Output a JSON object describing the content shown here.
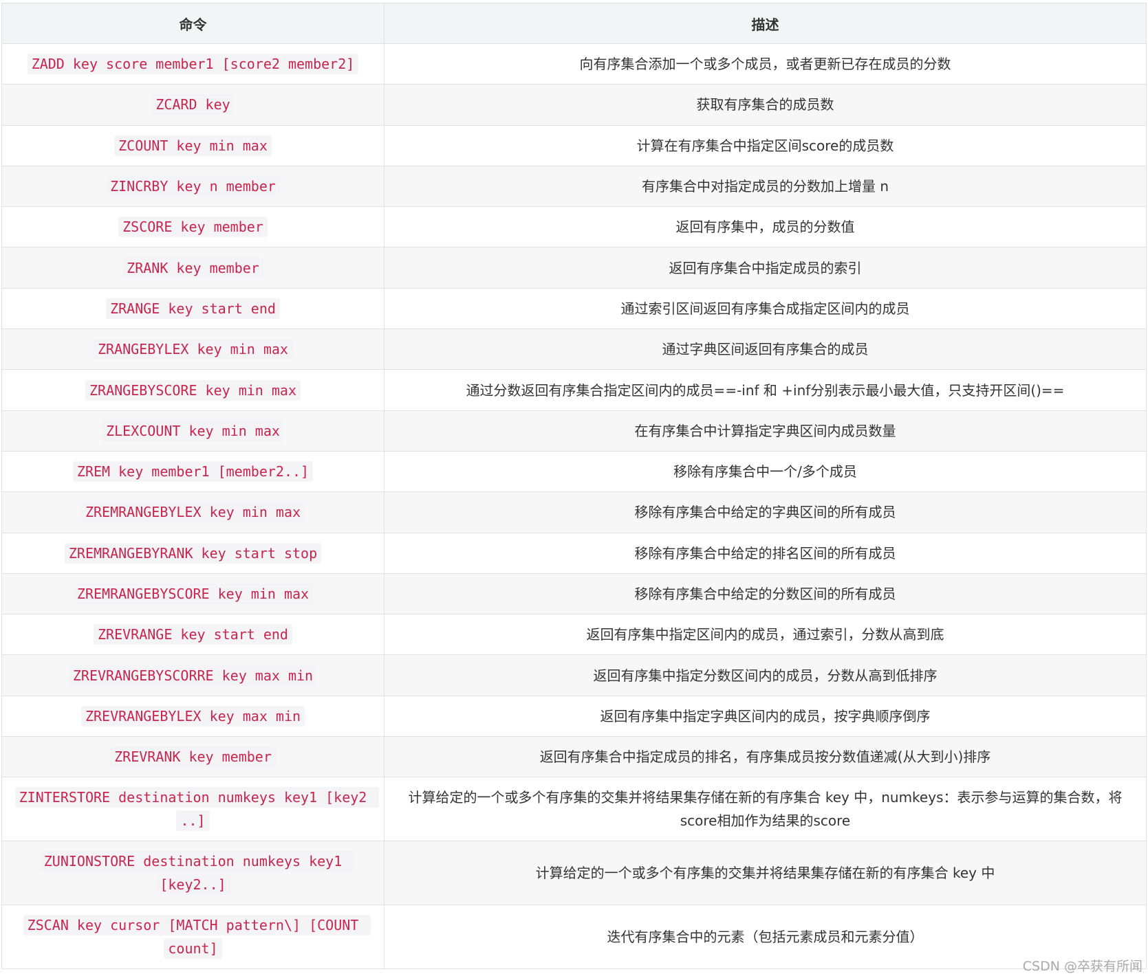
{
  "table": {
    "headers": [
      "命令",
      "描述"
    ],
    "rows": [
      {
        "command": "ZADD key score member1 [score2 member2]",
        "description": "向有序集合添加一个或多个成员，或者更新已存在成员的分数"
      },
      {
        "command": "ZCARD key",
        "description": "获取有序集合的成员数"
      },
      {
        "command": "ZCOUNT key min max",
        "description": "计算在有序集合中指定区间score的成员数"
      },
      {
        "command": "ZINCRBY key n member",
        "description": "有序集合中对指定成员的分数加上增量 n"
      },
      {
        "command": "ZSCORE key member",
        "description": "返回有序集中，成员的分数值"
      },
      {
        "command": "ZRANK key member",
        "description": "返回有序集合中指定成员的索引"
      },
      {
        "command": "ZRANGE key start end",
        "description": "通过索引区间返回有序集合成指定区间内的成员"
      },
      {
        "command": "ZRANGEBYLEX key min max",
        "description": "通过字典区间返回有序集合的成员"
      },
      {
        "command": "ZRANGEBYSCORE key min max",
        "description": "通过分数返回有序集合指定区间内的成员==-inf 和 +inf分别表示最小最大值，只支持开区间()=="
      },
      {
        "command": "ZLEXCOUNT key min max",
        "description": "在有序集合中计算指定字典区间内成员数量"
      },
      {
        "command": "ZREM key member1 [member2..]",
        "description": "移除有序集合中一个/多个成员"
      },
      {
        "command": "ZREMRANGEBYLEX key min max",
        "description": "移除有序集合中给定的字典区间的所有成员"
      },
      {
        "command": "ZREMRANGEBYRANK key start stop",
        "description": "移除有序集合中给定的排名区间的所有成员"
      },
      {
        "command": "ZREMRANGEBYSCORE key min max",
        "description": "移除有序集合中给定的分数区间的所有成员"
      },
      {
        "command": "ZREVRANGE key start end",
        "description": "返回有序集中指定区间内的成员，通过索引，分数从高到底"
      },
      {
        "command": "ZREVRANGEBYSCORRE key max min",
        "description": "返回有序集中指定分数区间内的成员，分数从高到低排序"
      },
      {
        "command": "ZREVRANGEBYLEX key max min",
        "description": "返回有序集中指定字典区间内的成员，按字典顺序倒序"
      },
      {
        "command": "ZREVRANK key member",
        "description": "返回有序集合中指定成员的排名，有序集成员按分数值递减(从大到小)排序"
      },
      {
        "command": "ZINTERSTORE destination numkeys key1 [key2 ..]",
        "description": "计算给定的一个或多个有序集的交集并将结果集存储在新的有序集合 key 中，numkeys：表示参与运算的集合数，将score相加作为结果的score"
      },
      {
        "command": "ZUNIONSTORE destination numkeys key1 [key2..]",
        "description": "计算给定的一个或多个有序集的交集并将结果集存储在新的有序集合 key 中"
      },
      {
        "command": "ZSCAN key cursor [MATCH pattern\\] [COUNT count]",
        "description": "迭代有序集合中的元素（包括元素成员和元素分值）"
      }
    ]
  },
  "watermark": "CSDN @卒获有所闻"
}
